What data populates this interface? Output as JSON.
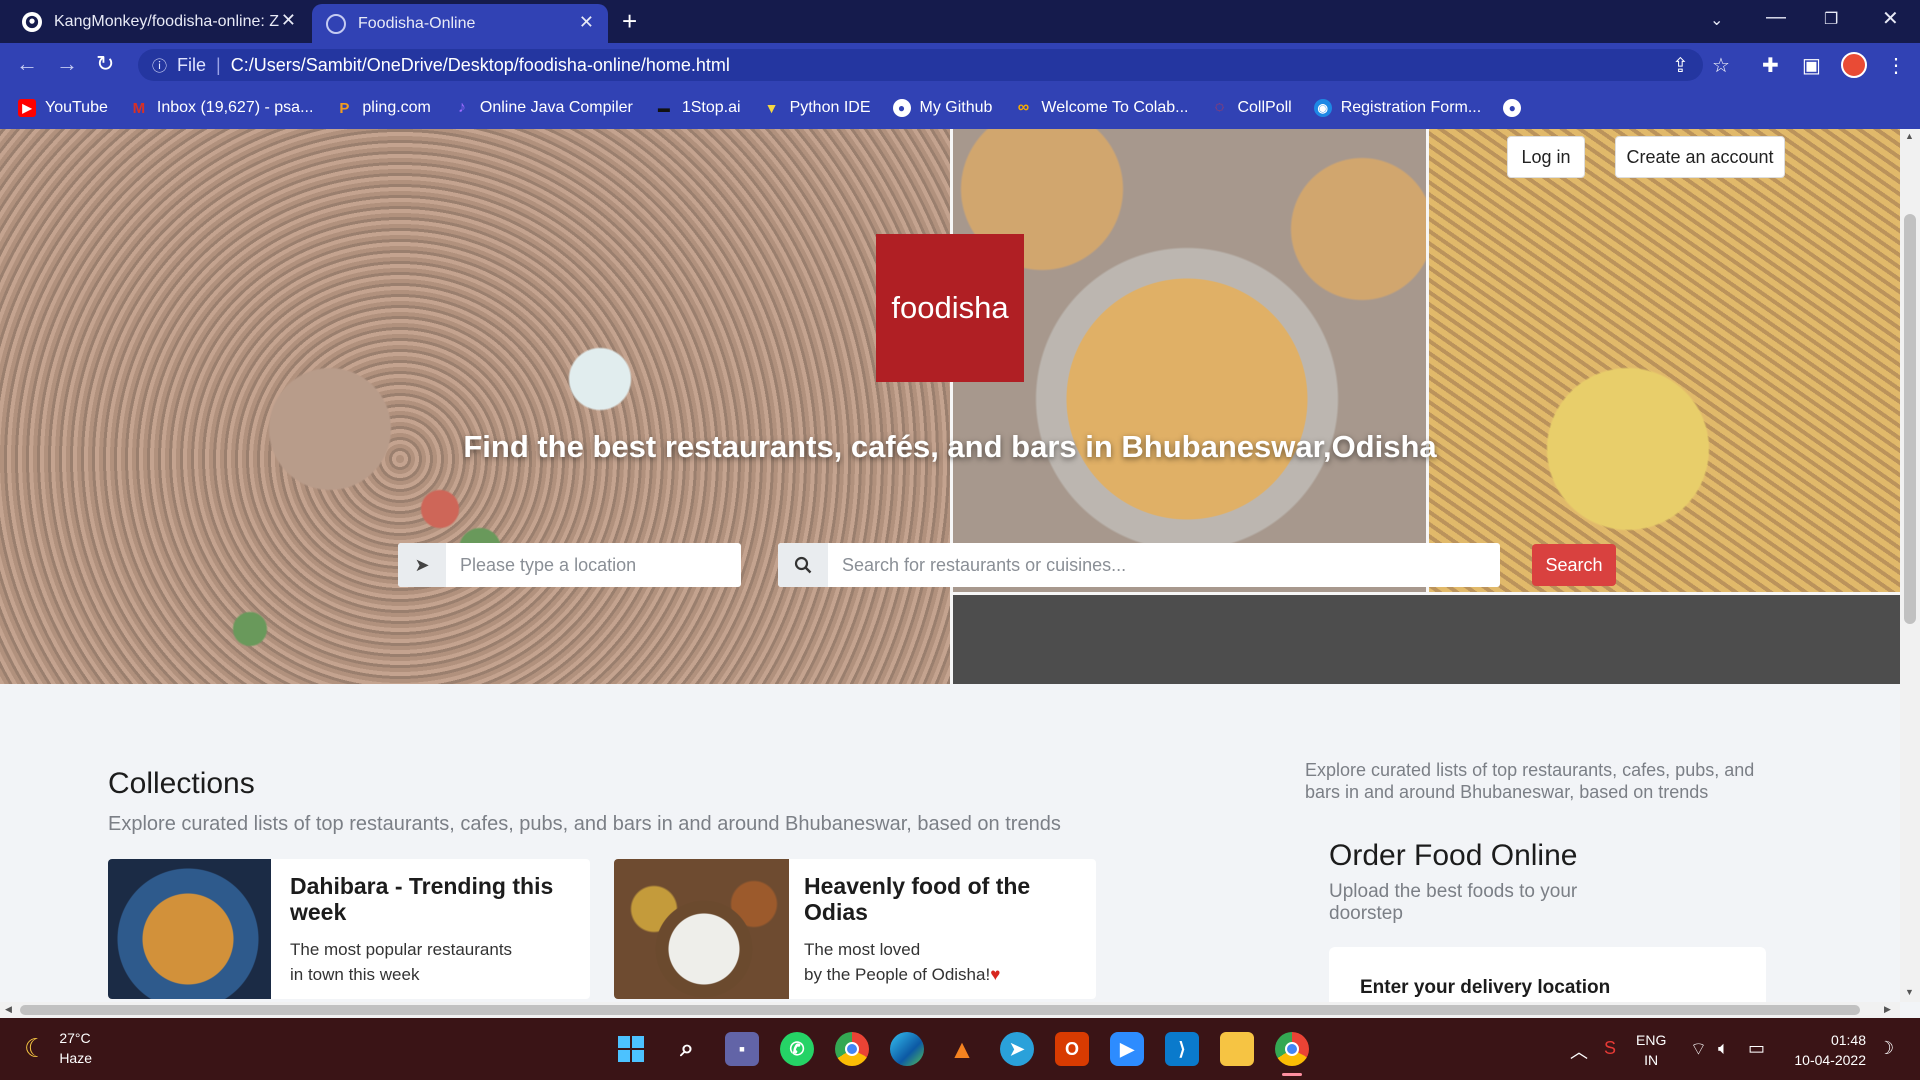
{
  "browser": {
    "tabs": [
      {
        "title": "KangMonkey/foodisha-online: Z",
        "icon": "github-icon"
      },
      {
        "title": "Foodisha-Online",
        "icon": "globe-icon"
      }
    ],
    "address": {
      "scheme": "File",
      "path": "C:/Users/Sambit/OneDrive/Desktop/foodisha-online/home.html"
    },
    "bookmarks": [
      {
        "label": "YouTube",
        "icon": "youtube-icon",
        "color": "#ff0000"
      },
      {
        "label": "Inbox (19,627) - psa...",
        "icon": "gmail-icon",
        "color": "#d93025"
      },
      {
        "label": "pling.com",
        "icon": "pling-icon",
        "color": "#f29c1f"
      },
      {
        "label": "Online Java Compiler",
        "icon": "java-icon",
        "color": "#7b3ff2"
      },
      {
        "label": "1Stop.ai",
        "icon": "onestop-icon",
        "color": "#222222"
      },
      {
        "label": "Python IDE",
        "icon": "python-icon",
        "color": "#4b8bbe"
      },
      {
        "label": "My Github",
        "icon": "github-icon",
        "color": "#ffffff"
      },
      {
        "label": "Welcome To Colab...",
        "icon": "colab-icon",
        "color": "#f9ab00"
      },
      {
        "label": "CollPoll",
        "icon": "collpoll-icon",
        "color": "#e53935"
      },
      {
        "label": "Registration Form...",
        "icon": "registration-icon",
        "color": "#1e88e5"
      }
    ]
  },
  "header": {
    "login_label": "Log in",
    "signup_label": "Create an account",
    "logo_text": "foodisha",
    "tagline": "Find the best restaurants, cafés, and bars in Bhubaneswar,Odisha"
  },
  "search": {
    "location_placeholder": "Please type a location",
    "query_placeholder": "Search for restaurants or cuisines...",
    "button_label": "Search"
  },
  "collections": {
    "title": "Collections",
    "subtitle": "Explore curated lists of top restaurants, cafes, pubs, and bars in and around Bhubaneswar, based on trends",
    "cards": [
      {
        "title": "Dahibara - Trending this week",
        "desc": "The most popular restaurants\nin town this week"
      },
      {
        "title": "Heavenly food of the Odias",
        "desc": "The most loved\nby the People of Odisha!"
      }
    ]
  },
  "sidebar": {
    "text": "Explore curated lists of top restaurants, cafes, pubs, and bars in and around Bhubaneswar, based on trends",
    "order_title": "Order Food Online",
    "order_sub": "Upload the best foods to your doorstep",
    "delivery_label": "Enter your delivery location"
  },
  "taskbar": {
    "temperature": "27°C",
    "weather": "Haze",
    "lang_top": "ENG",
    "lang_bottom": "IN",
    "time": "01:48",
    "date": "10-04-2022"
  },
  "colors": {
    "tab_bar": "#151b4c",
    "toolbar": "#3142b4",
    "logo_bg": "#b01f24",
    "search_button": "#d9413f",
    "taskbar": "#3a1416"
  }
}
